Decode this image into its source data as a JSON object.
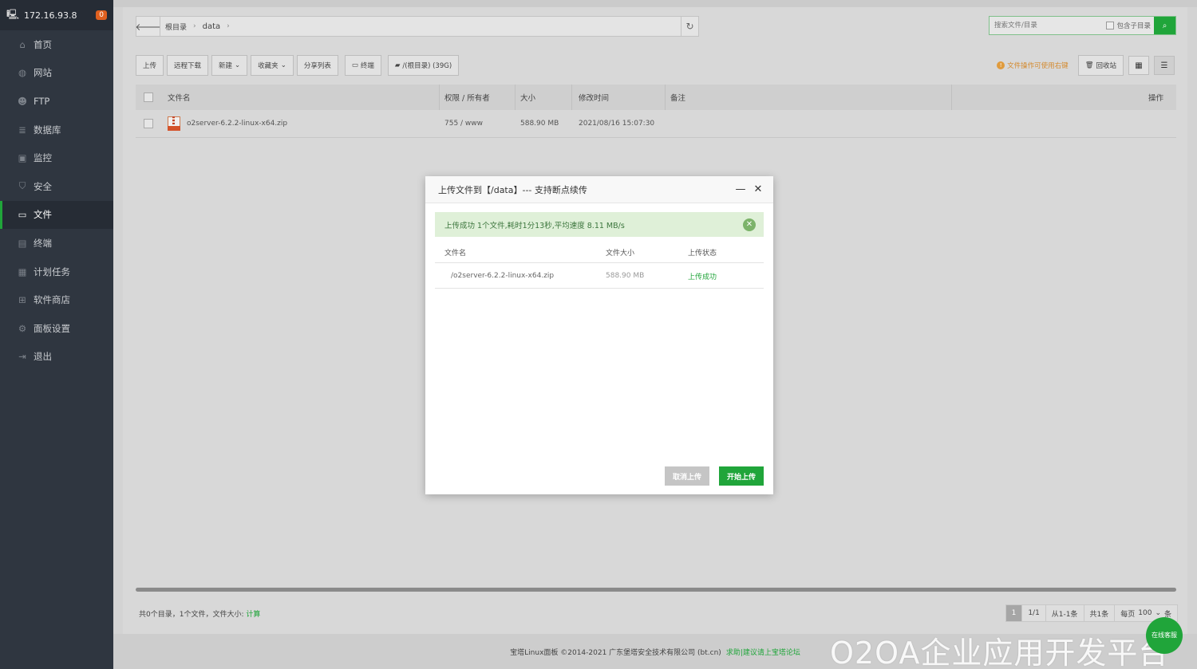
{
  "sidebar": {
    "server_ip": "172.16.93.8",
    "badge": "0",
    "items": [
      {
        "label": "首页",
        "icon": "home-icon"
      },
      {
        "label": "网站",
        "icon": "globe-icon"
      },
      {
        "label": "FTP",
        "icon": "user-icon"
      },
      {
        "label": "数据库",
        "icon": "database-icon"
      },
      {
        "label": "监控",
        "icon": "monitor-icon"
      },
      {
        "label": "安全",
        "icon": "shield-icon"
      },
      {
        "label": "文件",
        "icon": "folder-icon",
        "active": true
      },
      {
        "label": "终端",
        "icon": "terminal-icon"
      },
      {
        "label": "计划任务",
        "icon": "calendar-icon"
      },
      {
        "label": "软件商店",
        "icon": "grid-icon"
      },
      {
        "label": "面板设置",
        "icon": "gear-icon"
      },
      {
        "label": "退出",
        "icon": "logout-icon"
      }
    ]
  },
  "path": {
    "root": "根目录",
    "current": "data"
  },
  "search": {
    "placeholder": "搜索文件/目录",
    "include_sub": "包含子目录"
  },
  "toolbar": {
    "upload": "上传",
    "remote_download": "远程下载",
    "new": "新建",
    "favorites": "收藏夹",
    "share_list": "分享列表",
    "terminal": "终端",
    "disk": "/(根目录) (39G)",
    "tip": "文件操作可使用右键",
    "recycle": "回收站"
  },
  "table": {
    "headers": {
      "name": "文件名",
      "perm": "权限 / 所有者",
      "size": "大小",
      "time": "修改时间",
      "note": "备注",
      "ops": "操作"
    },
    "rows": [
      {
        "name": "o2server-6.2.2-linux-x64.zip",
        "perm": "755 / www",
        "size": "588.90 MB",
        "time": "2021/08/16 15:07:30"
      }
    ]
  },
  "stats": {
    "text": "共0个目录，1个文件，文件大小:",
    "calc": "计算"
  },
  "pager": {
    "current": "1",
    "pages": "1/1",
    "range": "从1-1条",
    "total": "共1条",
    "per_page_label": "每页",
    "per_page": "100",
    "unit": "条"
  },
  "footer": {
    "copyright": "宝塔Linux面板 ©2014-2021 广东堡塔安全技术有限公司 (bt.cn)",
    "link": "求助|建议请上宝塔论坛"
  },
  "modal": {
    "title": "上传文件到【/data】--- 支持断点续传",
    "alert": "上传成功 1个文件,耗时1分13秒,平均速度 8.11 MB/s",
    "headers": {
      "name": "文件名",
      "size": "文件大小",
      "status": "上传状态"
    },
    "rows": [
      {
        "name": "/o2server-6.2.2-linux-x64.zip",
        "size": "588.90 MB",
        "status": "上传成功"
      }
    ],
    "cancel": "取消上传",
    "start": "开始上传"
  },
  "watermark": "O2OA企业应用开发平台",
  "online_service": "在线客服",
  "colors": {
    "accent": "#20a53a",
    "sidebar": "#2f3640",
    "badge": "#e0601f"
  }
}
